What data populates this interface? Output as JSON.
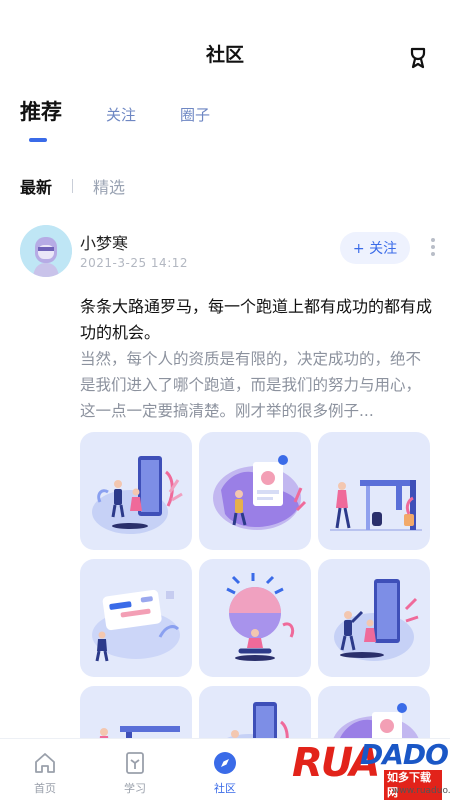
{
  "header": {
    "title": "社区"
  },
  "tabs": [
    {
      "label": "推荐"
    },
    {
      "label": "关注"
    },
    {
      "label": "圈子"
    }
  ],
  "subtabs": [
    {
      "label": "最新"
    },
    {
      "label": "精选"
    }
  ],
  "post": {
    "username": "小梦寒",
    "time": "2021-3-25  14:12",
    "follow_label": "+ 关注",
    "title": "条条大路通罗马，每一个跑道上都有成功的都有成功的机会。",
    "body": "当然，每个人的资质是有限的，决定成功的，绝不是我们进入了哪个跑道，而是我们的努力与用心，这一点一定要搞清楚。刚才举的很多例子..."
  },
  "nav": [
    {
      "label": "首页",
      "icon": "home-icon"
    },
    {
      "label": "学习",
      "icon": "book-icon"
    },
    {
      "label": "社区",
      "icon": "compass-icon"
    }
  ],
  "watermark": {
    "brand": "RUANDADO",
    "cn": "如多下载网",
    "url": "www.ruaduo.com"
  },
  "colors": {
    "accent": "#3a6be8",
    "tab_inactive": "#6e87c3",
    "card_bg": "#e3e9fb"
  }
}
